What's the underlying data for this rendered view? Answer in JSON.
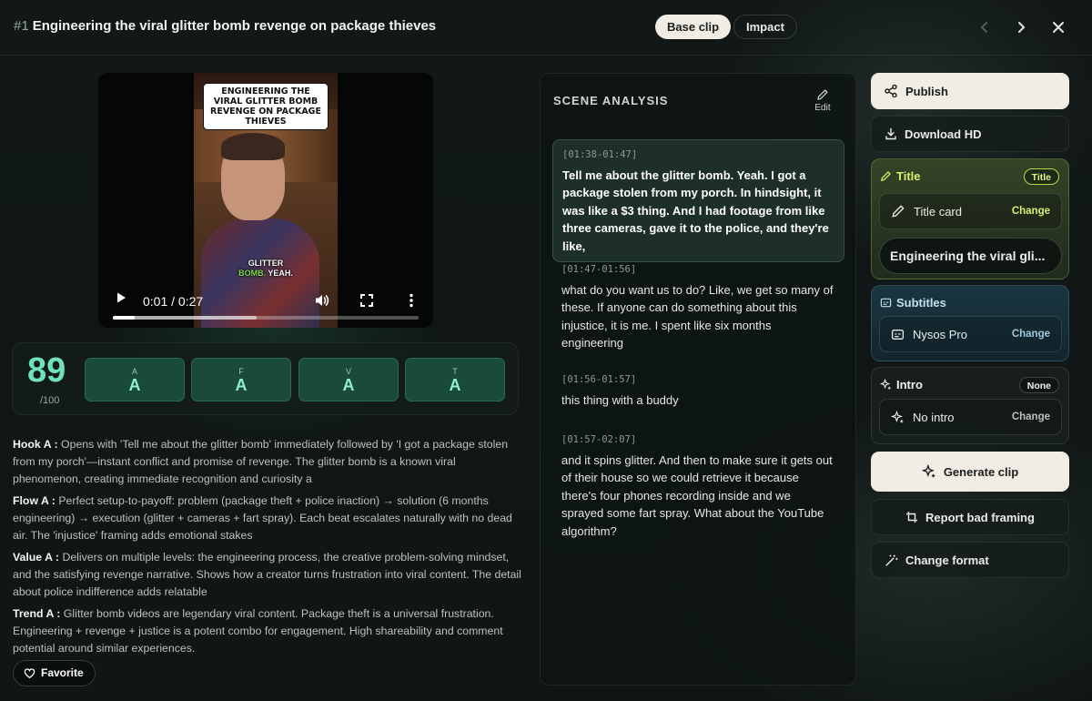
{
  "header": {
    "num": "#1",
    "title": "Engineering the viral glitter bomb revenge on package thieves",
    "tabs": [
      "Base clip",
      "Impact"
    ]
  },
  "video": {
    "caption": "ENGINEERING THE VIRAL GLITTER BOMB REVENGE ON PACKAGE THIEVES",
    "subtitle_line1": "GLITTER",
    "subtitle_word_highlight": "BOMB.",
    "subtitle_word_rest": " YEAH.",
    "time": "0:01 / 0:27",
    "progress": 0.07,
    "buffered": 0.47
  },
  "score": {
    "value": "89",
    "max": "/100",
    "grades": [
      {
        "label": "A",
        "value": "A"
      },
      {
        "label": "F",
        "value": "A"
      },
      {
        "label": "V",
        "value": "A"
      },
      {
        "label": "T",
        "value": "A"
      }
    ]
  },
  "details": [
    {
      "head": "Hook A :",
      "text": " Opens with 'Tell me about the glitter bomb' immediately followed by 'I got a package stolen from my porch'—instant conflict and promise of revenge. The glitter bomb is a known viral phenomenon, creating immediate recognition and curiosity a"
    },
    {
      "head": "Flow A :",
      "text": " Perfect setup-to-payoff: problem (package theft + police inaction) → solution (6 months engineering) → execution (glitter + cameras + fart spray). Each beat escalates naturally with no dead air. The 'injustice' framing adds emotional stakes"
    },
    {
      "head": "Value A :",
      "text": " Delivers on multiple levels: the engineering process, the creative problem-solving mindset, and the satisfying revenge narrative. Shows how a creator turns frustration into viral content. The detail about police indifference adds relatable"
    },
    {
      "head": "Trend A :",
      "text": " Glitter bomb videos are legendary viral content. Package theft is a universal frustration. Engineering + revenge + justice is a potent combo for engagement. High shareability and comment potential around similar experiences."
    }
  ],
  "favorite_label": "Favorite",
  "scene": {
    "title": "SCENE ANALYSIS",
    "edit_label": "Edit",
    "segments": [
      {
        "ts": "[01:38-01:47]",
        "text": "Tell me about the glitter bomb. Yeah. I got a package stolen from my porch. In hindsight, it was like a $3 thing. And I had footage from like three cameras, gave it to the police, and they're like,"
      },
      {
        "ts": "[01:47-01:56]",
        "text": "what do you want us to do? Like, we get so many of these. If anyone can do something about this injustice, it is me. I spent like six months engineering"
      },
      {
        "ts": "[01:56-01:57]",
        "text": "this thing with a buddy"
      },
      {
        "ts": "[01:57-02:07]",
        "text": "and it spins glitter. And then to make sure it gets out of their house so we could retrieve it because there's four phones recording inside and we sprayed some fart spray. What about the YouTube algorithm?"
      }
    ]
  },
  "sidebar": {
    "publish": "Publish",
    "download": "Download HD",
    "title_card": {
      "head": "Title",
      "pill": "Title",
      "row_label": "Title card",
      "change": "Change",
      "value": "Engineering the viral gli..."
    },
    "subtitles": {
      "head": "Subtitles",
      "row_label": "Nysos Pro",
      "change": "Change"
    },
    "intro": {
      "head": "Intro",
      "pill": "None",
      "row_label": "No intro",
      "change": "Change"
    },
    "generate": "Generate clip",
    "report": "Report bad framing",
    "format": "Change format"
  },
  "colors": {
    "accent_green": "#6fe3b7",
    "title_yellow": "#d8f06a",
    "subtitle_blue": "#8fc0e0",
    "panel_cream": "#f1ede4"
  }
}
